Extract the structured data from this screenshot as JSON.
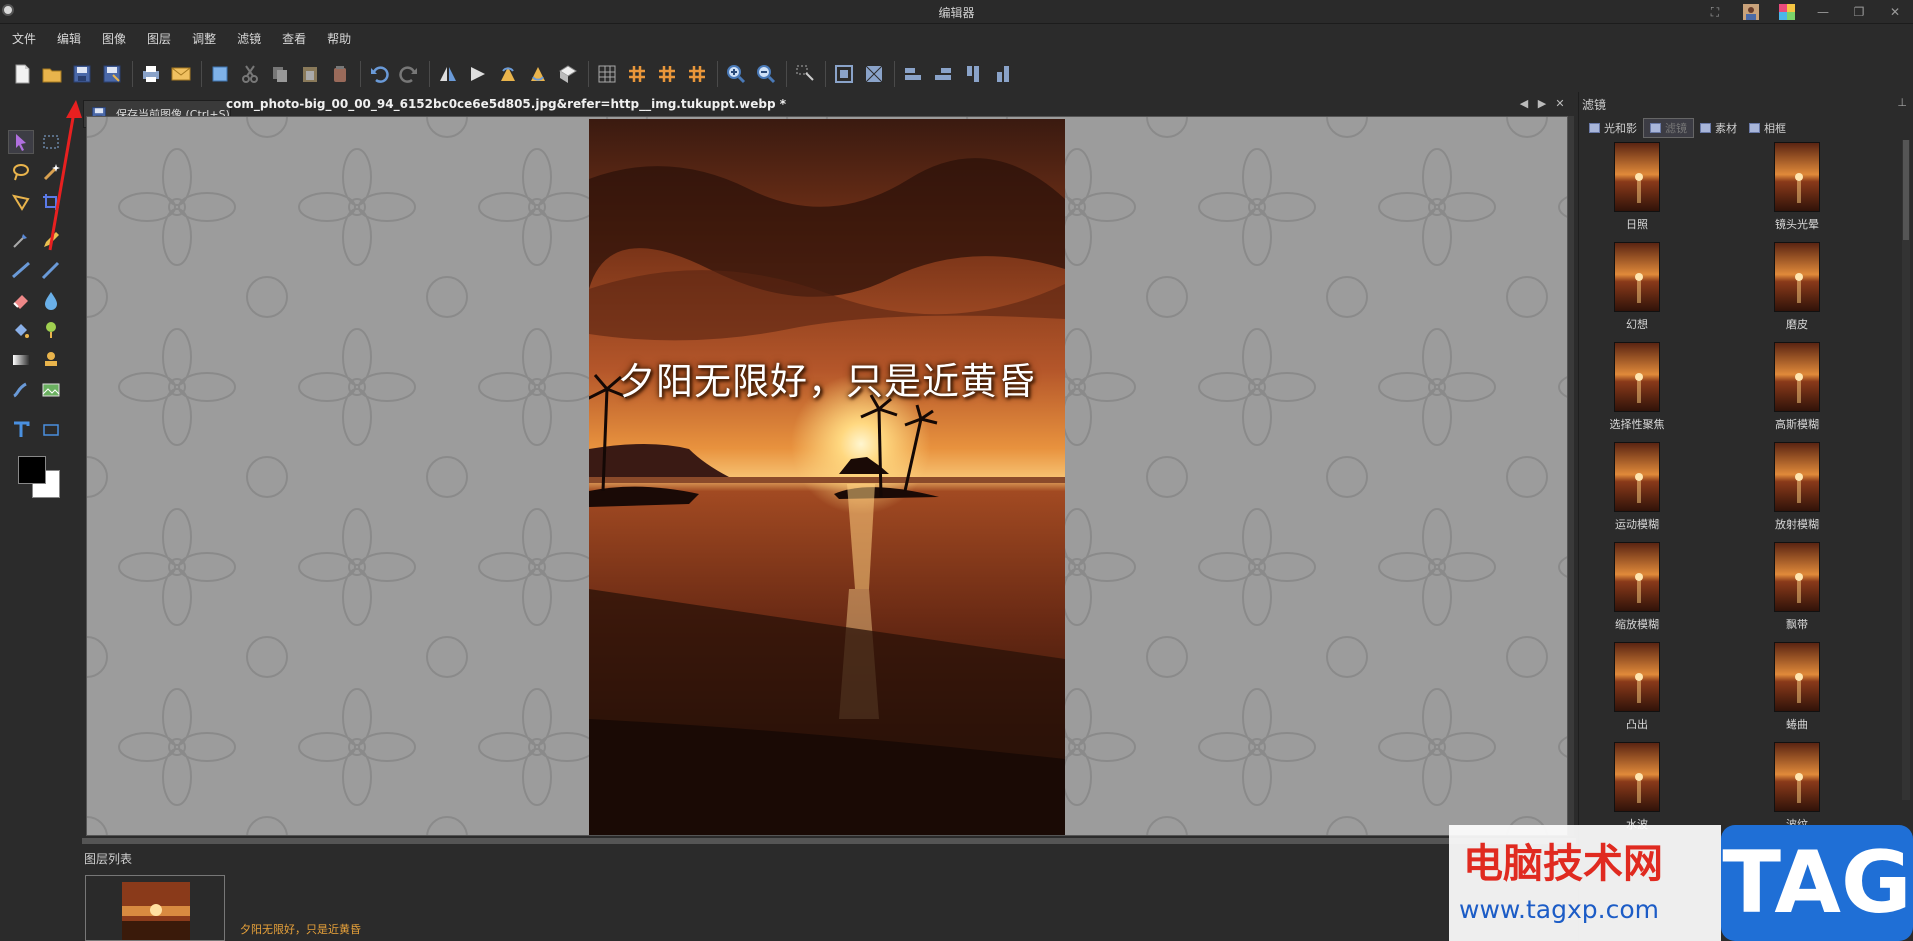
{
  "app": {
    "title": "编辑器"
  },
  "menu": [
    "文件",
    "编辑",
    "图像",
    "图层",
    "调整",
    "滤镜",
    "查看",
    "帮助"
  ],
  "tooltip": {
    "text": "保存当前图像 (Ctrl+S)"
  },
  "document_tab": {
    "label": "com_photo-big_00_00_94_6152bc0ce6e5d805.jpg&refer=http__img.tukuppt.webp *"
  },
  "photo": {
    "caption": "夕阳无限好，只是近黄昏"
  },
  "layers": {
    "title": "图层列表",
    "items": [
      {
        "name": "夕阳无限好，只是近黄昏"
      }
    ]
  },
  "right_panel": {
    "title": "滤镜",
    "pin": "⊥",
    "tabs": [
      {
        "label": "光和影"
      },
      {
        "label": "滤镜",
        "selected": true
      },
      {
        "label": "素材"
      },
      {
        "label": "相框"
      }
    ],
    "filters": [
      "日照",
      "镜头光晕",
      "幻想",
      "磨皮",
      "选择性聚焦",
      "高斯模糊",
      "运动模糊",
      "放射模糊",
      "缩放模糊",
      "飘带",
      "凸出",
      "蜷曲",
      "水波",
      "波纹"
    ]
  },
  "watermark": {
    "title": "电脑技术网",
    "url": "www.tagxp.com",
    "tag": "TAG"
  },
  "colors": {
    "foreground": "#000000",
    "background": "#ffffff",
    "accent_tag": "#1f6fd6",
    "watermark_red": "#e02a20"
  }
}
